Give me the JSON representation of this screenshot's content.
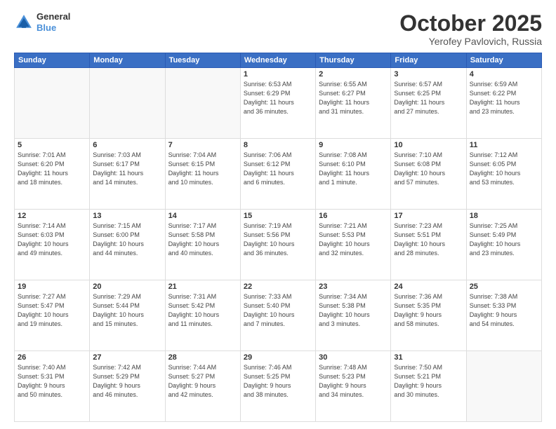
{
  "header": {
    "logo_line1": "General",
    "logo_line2": "Blue",
    "main_title": "October 2025",
    "subtitle": "Yerofey Pavlovich, Russia"
  },
  "calendar": {
    "days_of_week": [
      "Sunday",
      "Monday",
      "Tuesday",
      "Wednesday",
      "Thursday",
      "Friday",
      "Saturday"
    ],
    "weeks": [
      [
        {
          "day": "",
          "info": ""
        },
        {
          "day": "",
          "info": ""
        },
        {
          "day": "",
          "info": ""
        },
        {
          "day": "1",
          "info": "Sunrise: 6:53 AM\nSunset: 6:29 PM\nDaylight: 11 hours\nand 36 minutes."
        },
        {
          "day": "2",
          "info": "Sunrise: 6:55 AM\nSunset: 6:27 PM\nDaylight: 11 hours\nand 31 minutes."
        },
        {
          "day": "3",
          "info": "Sunrise: 6:57 AM\nSunset: 6:25 PM\nDaylight: 11 hours\nand 27 minutes."
        },
        {
          "day": "4",
          "info": "Sunrise: 6:59 AM\nSunset: 6:22 PM\nDaylight: 11 hours\nand 23 minutes."
        }
      ],
      [
        {
          "day": "5",
          "info": "Sunrise: 7:01 AM\nSunset: 6:20 PM\nDaylight: 11 hours\nand 18 minutes."
        },
        {
          "day": "6",
          "info": "Sunrise: 7:03 AM\nSunset: 6:17 PM\nDaylight: 11 hours\nand 14 minutes."
        },
        {
          "day": "7",
          "info": "Sunrise: 7:04 AM\nSunset: 6:15 PM\nDaylight: 11 hours\nand 10 minutes."
        },
        {
          "day": "8",
          "info": "Sunrise: 7:06 AM\nSunset: 6:12 PM\nDaylight: 11 hours\nand 6 minutes."
        },
        {
          "day": "9",
          "info": "Sunrise: 7:08 AM\nSunset: 6:10 PM\nDaylight: 11 hours\nand 1 minute."
        },
        {
          "day": "10",
          "info": "Sunrise: 7:10 AM\nSunset: 6:08 PM\nDaylight: 10 hours\nand 57 minutes."
        },
        {
          "day": "11",
          "info": "Sunrise: 7:12 AM\nSunset: 6:05 PM\nDaylight: 10 hours\nand 53 minutes."
        }
      ],
      [
        {
          "day": "12",
          "info": "Sunrise: 7:14 AM\nSunset: 6:03 PM\nDaylight: 10 hours\nand 49 minutes."
        },
        {
          "day": "13",
          "info": "Sunrise: 7:15 AM\nSunset: 6:00 PM\nDaylight: 10 hours\nand 44 minutes."
        },
        {
          "day": "14",
          "info": "Sunrise: 7:17 AM\nSunset: 5:58 PM\nDaylight: 10 hours\nand 40 minutes."
        },
        {
          "day": "15",
          "info": "Sunrise: 7:19 AM\nSunset: 5:56 PM\nDaylight: 10 hours\nand 36 minutes."
        },
        {
          "day": "16",
          "info": "Sunrise: 7:21 AM\nSunset: 5:53 PM\nDaylight: 10 hours\nand 32 minutes."
        },
        {
          "day": "17",
          "info": "Sunrise: 7:23 AM\nSunset: 5:51 PM\nDaylight: 10 hours\nand 28 minutes."
        },
        {
          "day": "18",
          "info": "Sunrise: 7:25 AM\nSunset: 5:49 PM\nDaylight: 10 hours\nand 23 minutes."
        }
      ],
      [
        {
          "day": "19",
          "info": "Sunrise: 7:27 AM\nSunset: 5:47 PM\nDaylight: 10 hours\nand 19 minutes."
        },
        {
          "day": "20",
          "info": "Sunrise: 7:29 AM\nSunset: 5:44 PM\nDaylight: 10 hours\nand 15 minutes."
        },
        {
          "day": "21",
          "info": "Sunrise: 7:31 AM\nSunset: 5:42 PM\nDaylight: 10 hours\nand 11 minutes."
        },
        {
          "day": "22",
          "info": "Sunrise: 7:33 AM\nSunset: 5:40 PM\nDaylight: 10 hours\nand 7 minutes."
        },
        {
          "day": "23",
          "info": "Sunrise: 7:34 AM\nSunset: 5:38 PM\nDaylight: 10 hours\nand 3 minutes."
        },
        {
          "day": "24",
          "info": "Sunrise: 7:36 AM\nSunset: 5:35 PM\nDaylight: 9 hours\nand 58 minutes."
        },
        {
          "day": "25",
          "info": "Sunrise: 7:38 AM\nSunset: 5:33 PM\nDaylight: 9 hours\nand 54 minutes."
        }
      ],
      [
        {
          "day": "26",
          "info": "Sunrise: 7:40 AM\nSunset: 5:31 PM\nDaylight: 9 hours\nand 50 minutes."
        },
        {
          "day": "27",
          "info": "Sunrise: 7:42 AM\nSunset: 5:29 PM\nDaylight: 9 hours\nand 46 minutes."
        },
        {
          "day": "28",
          "info": "Sunrise: 7:44 AM\nSunset: 5:27 PM\nDaylight: 9 hours\nand 42 minutes."
        },
        {
          "day": "29",
          "info": "Sunrise: 7:46 AM\nSunset: 5:25 PM\nDaylight: 9 hours\nand 38 minutes."
        },
        {
          "day": "30",
          "info": "Sunrise: 7:48 AM\nSunset: 5:23 PM\nDaylight: 9 hours\nand 34 minutes."
        },
        {
          "day": "31",
          "info": "Sunrise: 7:50 AM\nSunset: 5:21 PM\nDaylight: 9 hours\nand 30 minutes."
        },
        {
          "day": "",
          "info": ""
        }
      ]
    ]
  }
}
